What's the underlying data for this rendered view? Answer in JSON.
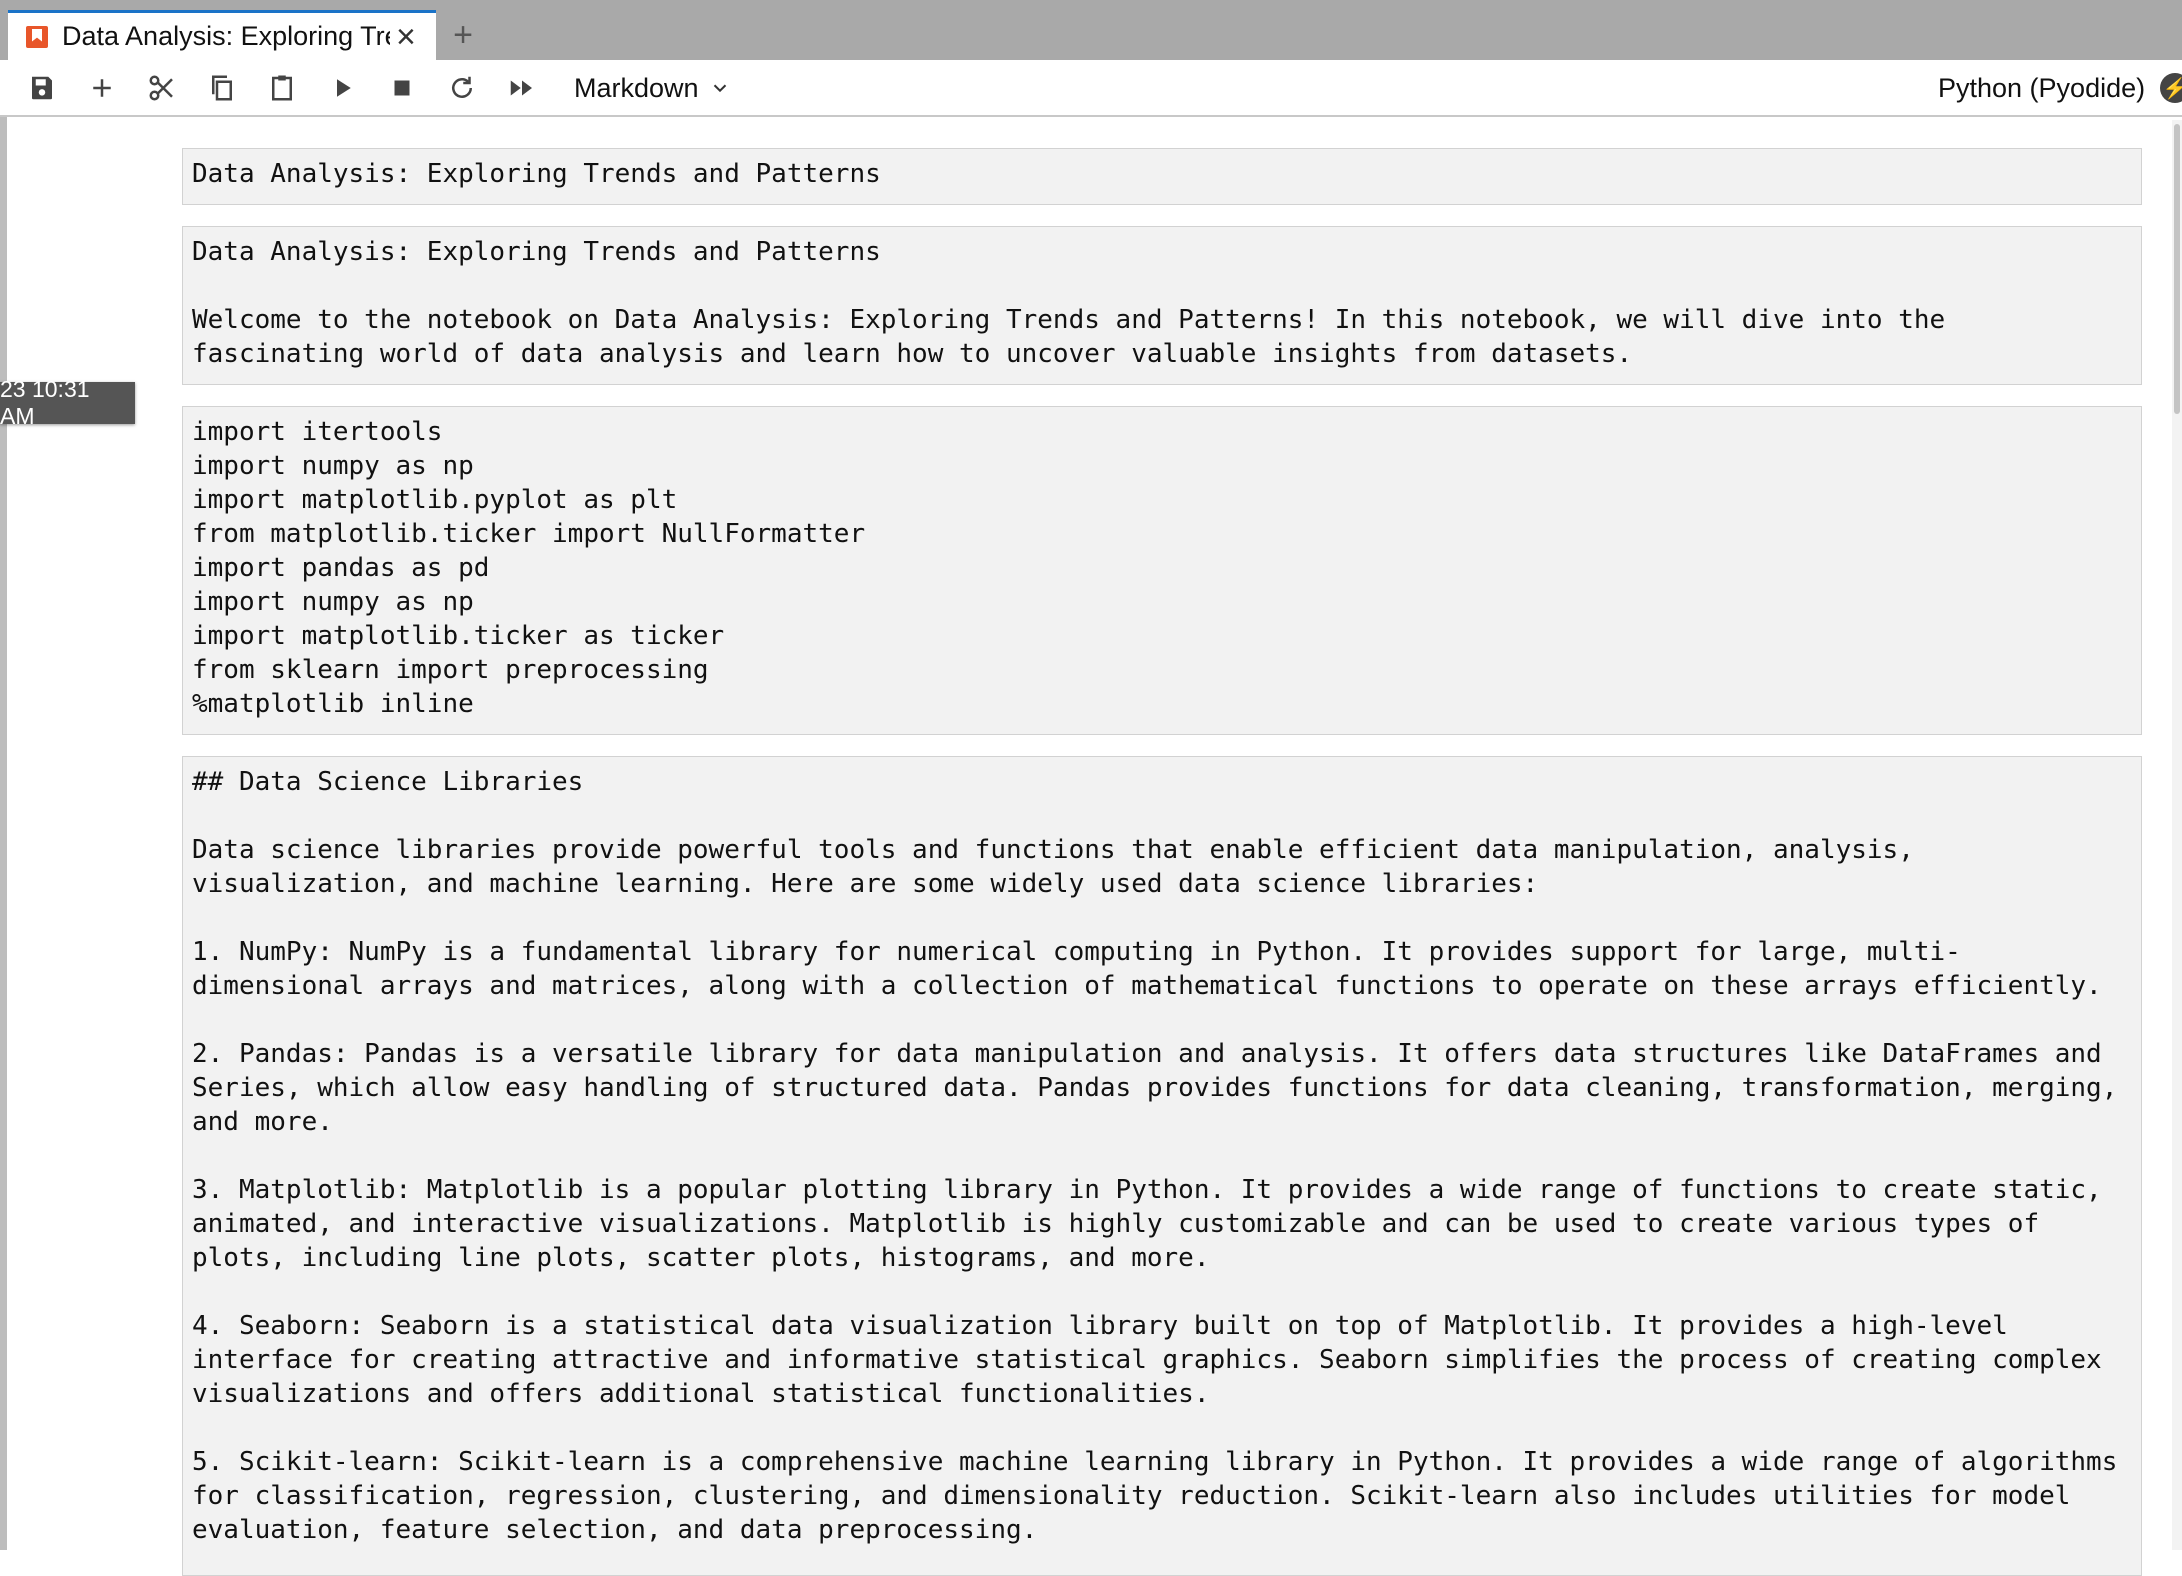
{
  "tab": {
    "title": "Data Analysis: Exploring Trends and Patterns",
    "add_label": "+"
  },
  "toolbar": {
    "cell_type": "Markdown",
    "kernel": "Python (Pyodide)",
    "buttons": [
      "save-icon",
      "plus-icon",
      "cut-icon",
      "copy-icon",
      "paste-icon",
      "run-icon",
      "stop-icon",
      "restart-icon",
      "run-all-icon"
    ]
  },
  "timestamp": "23 10:31 AM",
  "cells": [
    {
      "text": "Data Analysis: Exploring Trends and Patterns"
    },
    {
      "text": "Data Analysis: Exploring Trends and Patterns\n\nWelcome to the notebook on Data Analysis: Exploring Trends and Patterns! In this notebook, we will dive into the\nfascinating world of data analysis and learn how to uncover valuable insights from datasets."
    },
    {
      "text": "import itertools\nimport numpy as np\nimport matplotlib.pyplot as plt\nfrom matplotlib.ticker import NullFormatter\nimport pandas as pd\nimport numpy as np\nimport matplotlib.ticker as ticker\nfrom sklearn import preprocessing\n%matplotlib inline"
    },
    {
      "text": "## Data Science Libraries\n\nData science libraries provide powerful tools and functions that enable efficient data manipulation, analysis,\nvisualization, and machine learning. Here are some widely used data science libraries:\n\n1. NumPy: NumPy is a fundamental library for numerical computing in Python. It provides support for large, multi-\ndimensional arrays and matrices, along with a collection of mathematical functions to operate on these arrays efficiently.\n\n2. Pandas: Pandas is a versatile library for data manipulation and analysis. It offers data structures like DataFrames and\nSeries, which allow easy handling of structured data. Pandas provides functions for data cleaning, transformation, merging,\nand more.\n\n3. Matplotlib: Matplotlib is a popular plotting library in Python. It provides a wide range of functions to create static,\nanimated, and interactive visualizations. Matplotlib is highly customizable and can be used to create various types of\nplots, including line plots, scatter plots, histograms, and more.\n\n4. Seaborn: Seaborn is a statistical data visualization library built on top of Matplotlib. It provides a high-level\ninterface for creating attractive and informative statistical graphics. Seaborn simplifies the process of creating complex\nvisualizations and offers additional statistical functionalities.\n\n5. Scikit-learn: Scikit-learn is a comprehensive machine learning library in Python. It provides a wide range of algorithms\nfor classification, regression, clustering, and dimensionality reduction. Scikit-learn also includes utilities for model\nevaluation, feature selection, and data preprocessing."
    }
  ]
}
